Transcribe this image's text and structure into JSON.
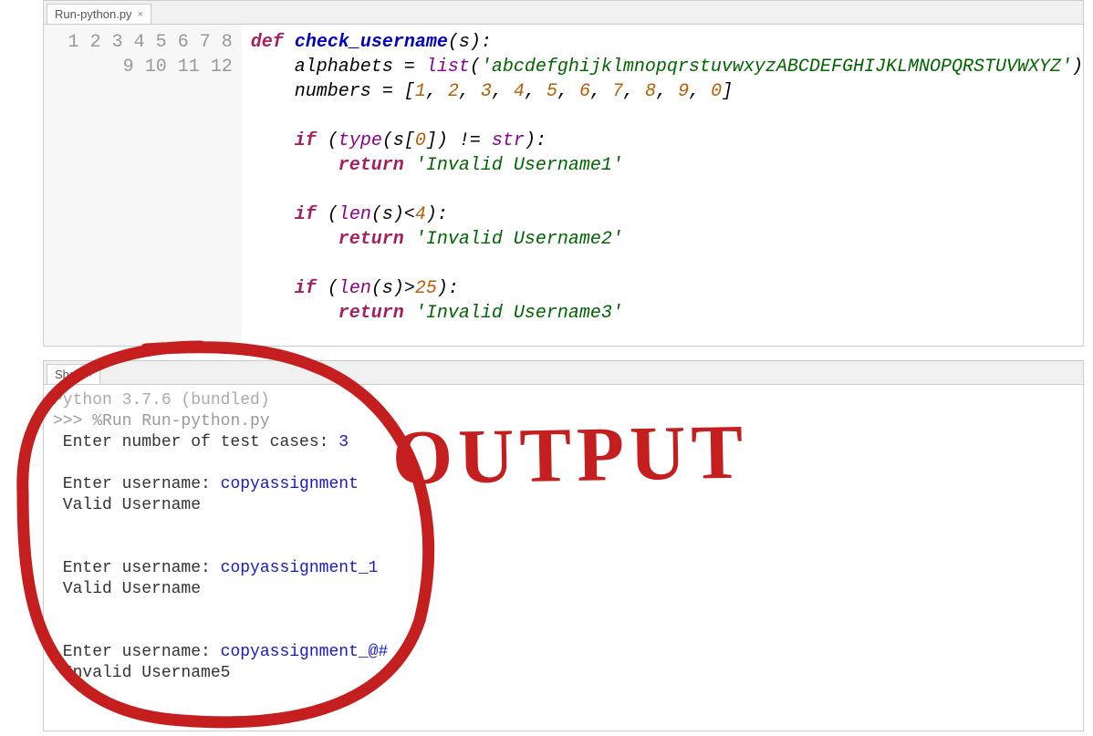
{
  "editor": {
    "tab": {
      "label": "Run-python.py"
    },
    "lines": [
      "1",
      "2",
      "3",
      "4",
      "5",
      "6",
      "7",
      "8",
      "9",
      "10",
      "11",
      "12"
    ],
    "code": {
      "l1": {
        "def": "def",
        "fn": "check_username",
        "rest": "(",
        "s": "s",
        "end": "):"
      },
      "l2": {
        "indent": "    ",
        "var": "alphabets",
        "eq": " = ",
        "builtin": "list",
        "open": "(",
        "str": "'abcdefghijklmnopqrstuvwxyzABCDEFGHIJKLMNOPQRSTUVWXYZ'",
        "close": ")"
      },
      "l3": {
        "indent": "    ",
        "var": "numbers",
        "eq": " = [",
        "nums": [
          1,
          2,
          3,
          4,
          5,
          6,
          7,
          8,
          9,
          0
        ],
        "close": "]"
      },
      "l5": {
        "indent": "    ",
        "if": "if",
        "open": " (",
        "type": "type",
        "p": "(",
        "s": "s",
        "idx": "[",
        "zero": "0",
        "idx2": "]) != ",
        "str": "str",
        "close": "):"
      },
      "l6": {
        "indent": "        ",
        "return": "return",
        "sp": " ",
        "str": "'Invalid Username1'"
      },
      "l8": {
        "indent": "    ",
        "if": "if",
        "open": " (",
        "len": "len",
        "p": "(",
        "s": "s",
        "cmp": ")<",
        "four": "4",
        "close": "):"
      },
      "l9": {
        "indent": "        ",
        "return": "return",
        "sp": " ",
        "str": "'Invalid Username2'"
      },
      "l11": {
        "indent": "    ",
        "if": "if",
        "open": " (",
        "len": "len",
        "p": "(",
        "s": "s",
        "cmp": ")>",
        "n": "25",
        "close": "):"
      },
      "l12": {
        "indent": "        ",
        "return": "return",
        "sp": " ",
        "str": "'Invalid Username3'"
      }
    }
  },
  "shell": {
    "tab": {
      "label": "Shell"
    },
    "banner": "Python 3.7.6 (bundled)",
    "prompt": ">>> ",
    "run_cmd": "%Run Run-python.py",
    "io": {
      "p1": " Enter number of test cases: ",
      "v1": "3",
      "p2": " Enter username: ",
      "v2": "copyassignment",
      "r2": " Valid Username",
      "p3": " Enter username: ",
      "v3": "copyassignment_1",
      "r3": " Valid Username",
      "p4": " Enter username: ",
      "v4": "copyassignment_@#",
      "r4": " Invalid Username5"
    }
  },
  "annotation": {
    "text": "OUTPUT",
    "color": "#c41e1e"
  }
}
